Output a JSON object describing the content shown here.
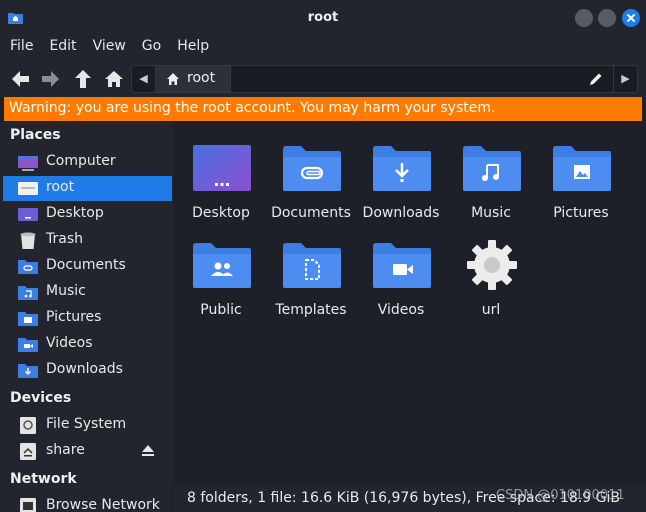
{
  "window": {
    "title": "root"
  },
  "menu": [
    "File",
    "Edit",
    "View",
    "Go",
    "Help"
  ],
  "pathbar": {
    "current": "root"
  },
  "warning": "Warning: you are using the root account. You may harm your system.",
  "sidebar": {
    "places_heading": "Places",
    "places": [
      {
        "label": "Computer",
        "icon": "computer-icon"
      },
      {
        "label": "root",
        "icon": "home-folder-icon",
        "active": true
      },
      {
        "label": "Desktop",
        "icon": "desktop-icon"
      },
      {
        "label": "Trash",
        "icon": "trash-icon"
      },
      {
        "label": "Documents",
        "icon": "documents-folder-icon"
      },
      {
        "label": "Music",
        "icon": "music-folder-icon"
      },
      {
        "label": "Pictures",
        "icon": "pictures-folder-icon"
      },
      {
        "label": "Videos",
        "icon": "videos-folder-icon"
      },
      {
        "label": "Downloads",
        "icon": "downloads-folder-icon"
      }
    ],
    "devices_heading": "Devices",
    "devices": [
      {
        "label": "File System",
        "icon": "drive-icon"
      },
      {
        "label": "share",
        "icon": "drive-icon"
      }
    ],
    "network_heading": "Network",
    "network": [
      {
        "label": "Browse Network",
        "icon": "network-icon"
      }
    ]
  },
  "files": [
    {
      "name": "Desktop",
      "icon": "desktop-folder-icon"
    },
    {
      "name": "Documents",
      "icon": "documents-folder-icon"
    },
    {
      "name": "Downloads",
      "icon": "downloads-folder-icon"
    },
    {
      "name": "Music",
      "icon": "music-folder-icon"
    },
    {
      "name": "Pictures",
      "icon": "pictures-folder-icon"
    },
    {
      "name": "Public",
      "icon": "public-folder-icon"
    },
    {
      "name": "Templates",
      "icon": "templates-folder-icon"
    },
    {
      "name": "Videos",
      "icon": "videos-folder-icon"
    },
    {
      "name": "url",
      "icon": "executable-gear-icon"
    }
  ],
  "status": "8 folders, 1 file: 16.6 KiB (16,976 bytes), Free space: 18.9 GiB",
  "watermark": "CSDN @010100011",
  "colors": {
    "accent": "#1f7be6",
    "warning": "#ff7b00",
    "folder": "#3d7ee3",
    "background": "#1e2029",
    "sidebar": "#23252e"
  }
}
